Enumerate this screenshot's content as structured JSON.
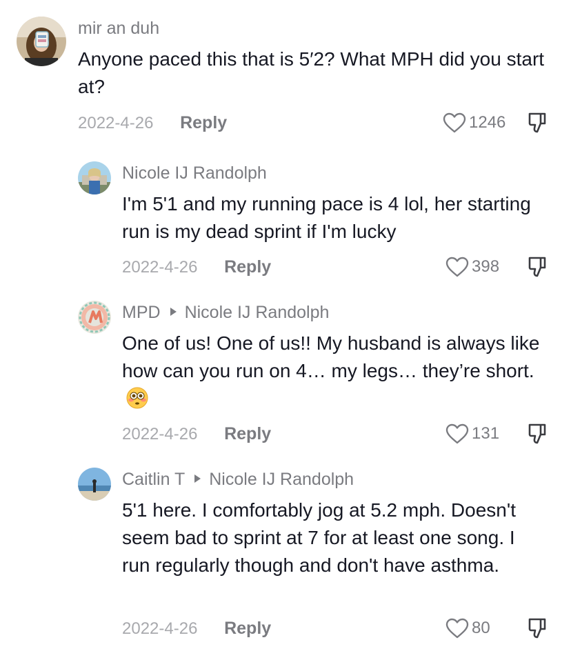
{
  "comments": [
    {
      "author": "mir an duh",
      "text": "Anyone paced this that is 5′2? What MPH did you start at?",
      "date": "2022-4-26",
      "reply_label": "Reply",
      "likes": "1246"
    },
    {
      "author": "Nicole IJ Randolph",
      "text": "I'm 5'1 and my running pace is 4 lol, her starting run is my dead sprint if I'm lucky",
      "date": "2022-4-26",
      "reply_label": "Reply",
      "likes": "398"
    },
    {
      "author": "MPD",
      "reply_to": "Nicole IJ Randolph",
      "text": "One of us! One of us!! My husband is always like how can you run on 4… my legs… they’re short.",
      "date": "2022-4-26",
      "reply_label": "Reply",
      "likes": "131"
    },
    {
      "author": "Caitlin T",
      "reply_to": "Nicole IJ Randolph",
      "text": "5'1 here. I comfortably jog at 5.2 mph. Doesn't seem bad to sprint at 7 for at least one song. I run regularly though and don't have asthma.",
      "date": "2022-4-26",
      "reply_label": "Reply",
      "likes": "80"
    }
  ],
  "icons": {
    "like": "heart-outline-icon",
    "dislike": "thumbs-down-icon",
    "reply_arrow": "caret-right-icon",
    "emoji": "flushed-face-emoji"
  },
  "colors": {
    "text_primary": "#161823",
    "text_secondary": "#7a7b80",
    "text_tertiary": "#a8a9ad"
  }
}
